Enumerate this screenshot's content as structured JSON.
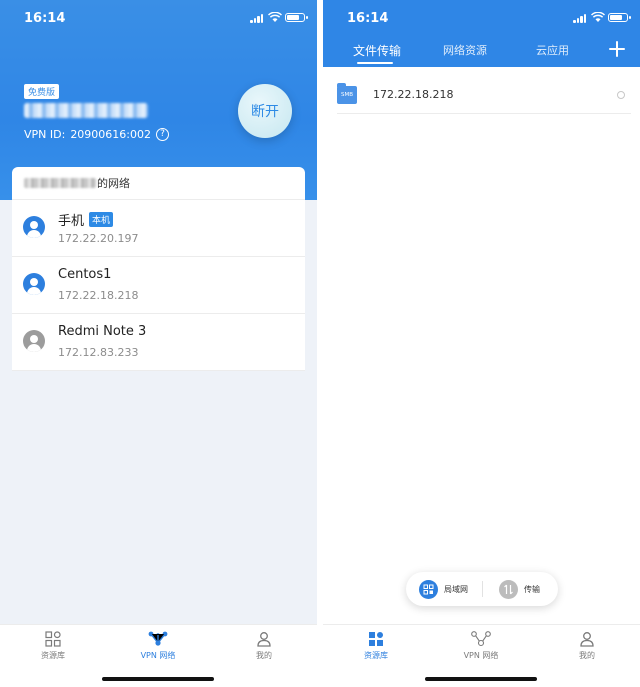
{
  "left": {
    "status_time": "16:14",
    "badge": "免费版",
    "vpn_id_label": "VPN ID:",
    "vpn_id_value": "20900616:002",
    "help_glyph": "?",
    "disconnect_label": "断开",
    "network_suffix": "的网络",
    "devices": [
      {
        "name": "手机",
        "tag": "本机",
        "ip": "172.22.20.197",
        "online": true
      },
      {
        "name": "Centos1",
        "tag": "",
        "ip": "172.22.18.218",
        "online": true
      },
      {
        "name": "Redmi Note 3",
        "tag": "",
        "ip": "172.12.83.233",
        "online": false
      }
    ],
    "tabbar": [
      {
        "label": "资源库",
        "icon": "grid-icon",
        "active": false
      },
      {
        "label": "VPN 网络",
        "icon": "network-icon",
        "active": true
      },
      {
        "label": "我的",
        "icon": "user-icon",
        "active": false
      }
    ]
  },
  "right": {
    "status_time": "16:14",
    "tabs": [
      {
        "label": "文件传输",
        "active": true
      },
      {
        "label": "网络资源",
        "active": false
      },
      {
        "label": "云应用",
        "active": false
      }
    ],
    "files": [
      {
        "type_label": "SMB",
        "ip": "172.22.18.218"
      }
    ],
    "pill": {
      "lan_label": "局域网",
      "transfer_label": "传输"
    },
    "tabbar": [
      {
        "label": "资源库",
        "icon": "grid-icon",
        "active": true
      },
      {
        "label": "VPN 网络",
        "icon": "network-icon",
        "active": false
      },
      {
        "label": "我的",
        "icon": "user-icon",
        "active": false
      }
    ]
  },
  "colors": {
    "brand_blue": "#2f86e6",
    "inactive_gray": "#7a7a7a"
  }
}
